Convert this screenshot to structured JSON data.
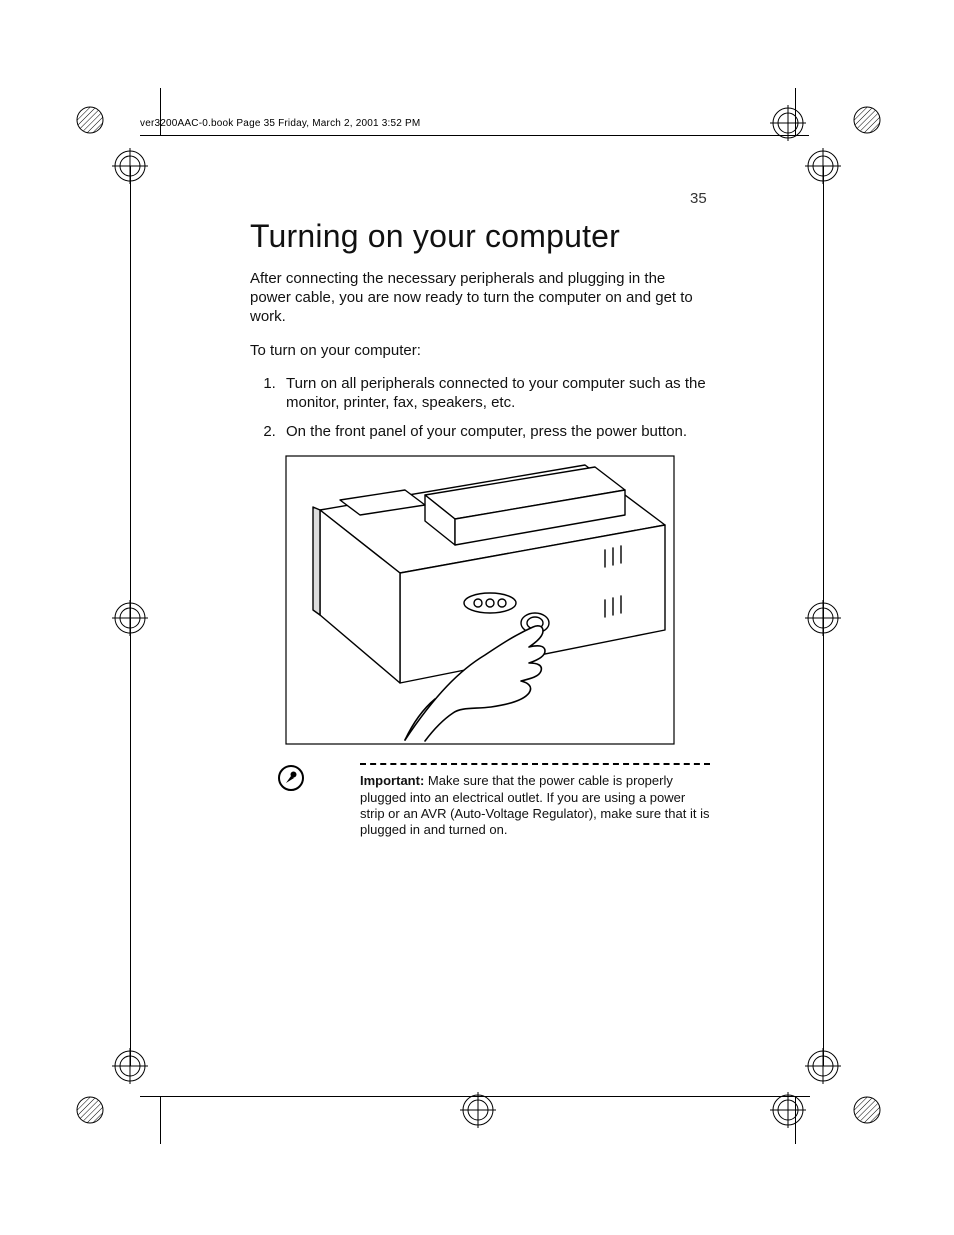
{
  "header_caption": "ver3200AAC-0.book  Page 35  Friday, March 2, 2001  3:52 PM",
  "page_number": "35",
  "title": "Turning on your computer",
  "intro": "After connecting the necessary peripherals and plugging in the power cable, you are now ready to turn the computer on and get to work.",
  "lead": "To turn on your computer:",
  "steps": [
    "Turn on all peripherals connected to your computer such as the monitor, printer, fax, speakers, etc.",
    "On the front panel of your computer, press the power button."
  ],
  "note": {
    "label": "Important:",
    "text": "  Make sure that the power cable is properly plugged into an electrical outlet. If you are using a power strip or an AVR (Auto-Voltage Regulator), make sure that it is plugged in and turned on."
  }
}
